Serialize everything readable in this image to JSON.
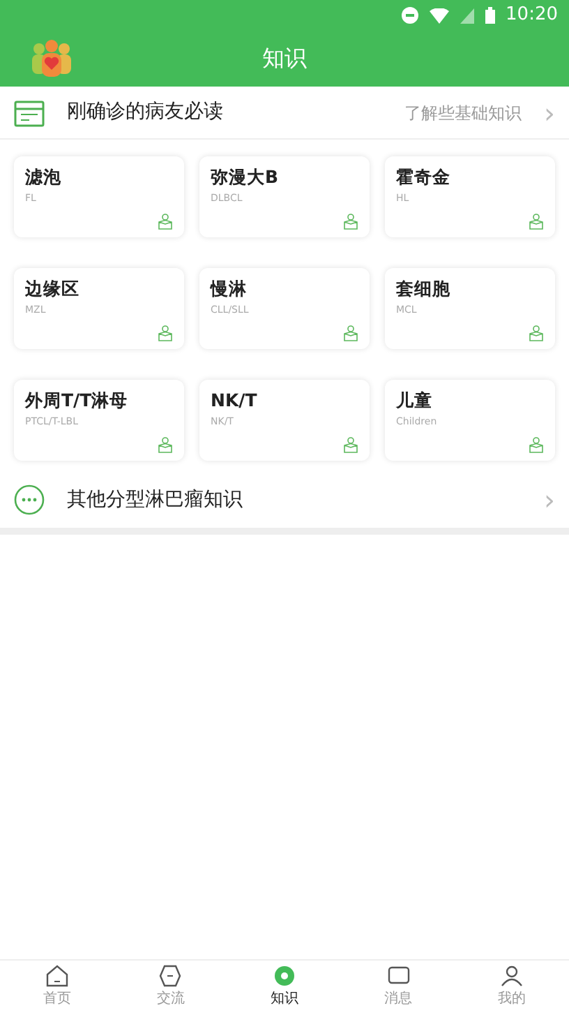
{
  "status_bar": {
    "time": "10:20"
  },
  "header": {
    "title": "知识"
  },
  "intro": {
    "title": "刚确诊的病友必读",
    "link": "了解些基础知识",
    "chevron": "›"
  },
  "cards": [
    {
      "name": "滤泡",
      "abbr": "FL"
    },
    {
      "name": "弥漫大B",
      "abbr": "DLBCL"
    },
    {
      "name": "霍奇金",
      "abbr": "HL"
    },
    {
      "name": "边缘区",
      "abbr": "MZL"
    },
    {
      "name": "慢淋",
      "abbr": "CLL/SLL"
    },
    {
      "name": "套细胞",
      "abbr": "MCL"
    },
    {
      "name": "外周T/T淋母",
      "abbr": "PTCL/T-LBL"
    },
    {
      "name": "NK/T",
      "abbr": "NK/T"
    },
    {
      "name": "儿童",
      "abbr": "Children"
    }
  ],
  "other": {
    "title": "其他分型淋巴瘤知识",
    "chevron": "›"
  },
  "tabs": [
    {
      "label": "首页",
      "kind": "home",
      "selected": false
    },
    {
      "label": "交流",
      "kind": "chat",
      "selected": false
    },
    {
      "label": "知识",
      "kind": "knowledge",
      "selected": true
    },
    {
      "label": "消息",
      "kind": "message",
      "selected": false
    },
    {
      "label": "我的",
      "kind": "me",
      "selected": false
    }
  ]
}
